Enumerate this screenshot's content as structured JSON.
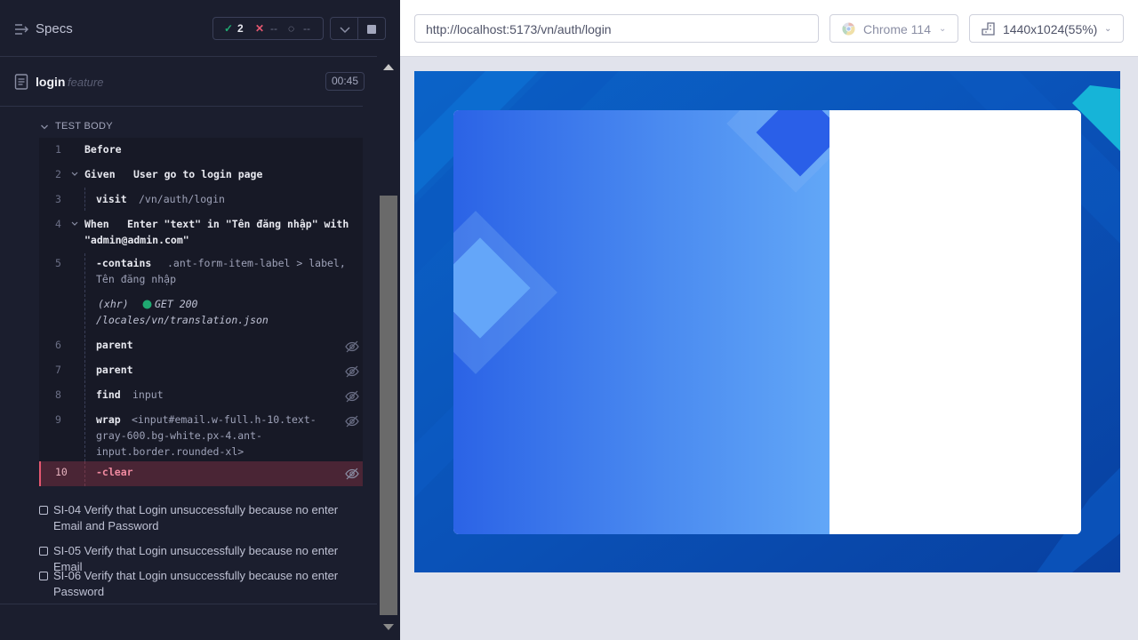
{
  "reporter": {
    "specs_label": "Specs",
    "stats": {
      "passed": "2",
      "failed": "--",
      "pending": "--"
    },
    "file": {
      "name": "login",
      "ext": "feature",
      "duration": "00:45"
    },
    "section_label": "TEST BODY",
    "commands": [
      {
        "num": "1",
        "cmd": "Before",
        "arg": ""
      },
      {
        "num": "2",
        "cmd": "Given",
        "arg": "User go to login page"
      },
      {
        "num": "3",
        "cmd": "visit",
        "arg": "/vn/auth/login"
      },
      {
        "num": "4",
        "cmd": "When",
        "arg_line1": "Enter \"text\" in \"Tên đăng nhập\" with",
        "arg_line2": "\"admin@admin.com\""
      },
      {
        "num": "5",
        "cmd": "-contains",
        "arg_line1": ".ant-form-item-label > label,",
        "arg_line2": "Tên đăng nhập"
      },
      {
        "xhr_label": "(xhr)",
        "xhr_request": "GET 200",
        "xhr_url": "/locales/vn/translation.json"
      },
      {
        "num": "6",
        "cmd": "parent",
        "arg": ""
      },
      {
        "num": "7",
        "cmd": "parent",
        "arg": ""
      },
      {
        "num": "8",
        "cmd": "find",
        "arg": "input"
      },
      {
        "num": "9",
        "cmd": "wrap",
        "arg_line1": "<input#email.w-full.h-10.text-",
        "arg_line2": "gray-600.bg-white.px-4.ant-",
        "arg_line3": "input.border.rounded-xl>"
      },
      {
        "num": "10",
        "cmd": "-clear",
        "arg": ""
      }
    ],
    "tests": [
      "SI-04 Verify that Login unsuccessfully because no enter Email and Password",
      "SI-05 Verify that Login unsuccessfully because no enter Email",
      "SI-06 Verify that Login unsuccessfully because no enter Password"
    ]
  },
  "aut_header": {
    "url": "http://localhost:5173/vn/auth/login",
    "browser": "Chrome 114",
    "viewport_size": "1440x1024",
    "viewport_scale": "(55%)"
  },
  "colors": {
    "pass": "#1fa971",
    "fail": "#e45770",
    "reporter_bg": "#1b1e2e",
    "aut_bg": "#0a4bb2",
    "card_gradient_start": "#2b63e6",
    "card_gradient_end": "#62a7f7"
  }
}
